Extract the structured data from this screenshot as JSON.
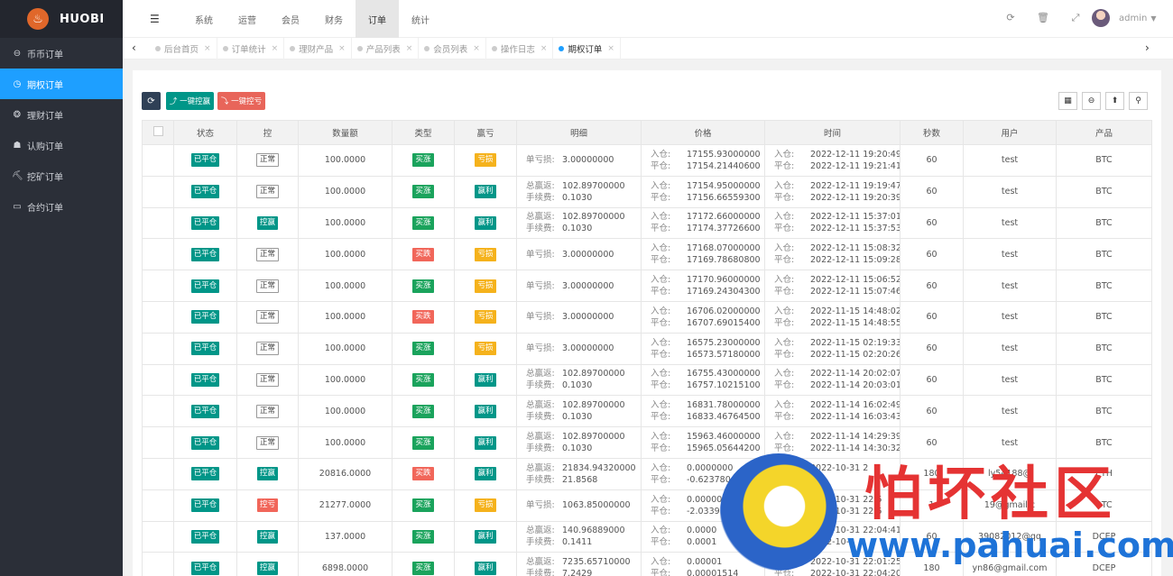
{
  "logo": {
    "text": "HUOBI"
  },
  "sidebar": {
    "items": [
      {
        "label": "币币订单",
        "icon": "coin-icon",
        "glyph": "⊖"
      },
      {
        "label": "期权订单",
        "icon": "clock-icon",
        "glyph": "◷"
      },
      {
        "label": "理财订单",
        "icon": "finance-icon",
        "glyph": "❂"
      },
      {
        "label": "认购订单",
        "icon": "person-walk-icon",
        "glyph": "☗"
      },
      {
        "label": "挖矿订单",
        "icon": "mining-icon",
        "glyph": "⛏"
      },
      {
        "label": "合约订单",
        "icon": "monitor-icon",
        "glyph": "▭"
      }
    ],
    "active_index": 1
  },
  "topnav": {
    "items": [
      "系统",
      "运营",
      "会员",
      "财务",
      "订单",
      "统计"
    ],
    "active_index": 4
  },
  "user": {
    "name": "admin"
  },
  "tabs": {
    "items": [
      "后台首页",
      "订单统计",
      "理财产品",
      "产品列表",
      "会员列表",
      "操作日志",
      "期权订单"
    ],
    "active_index": 6
  },
  "toolbar": {
    "refresh": "⟳",
    "btn_win": "⤴ 一键控赢",
    "btn_lose": "⤵ 一键控亏"
  },
  "table": {
    "headers": [
      "状态",
      "控",
      "数量额",
      "类型",
      "赢亏",
      "明细",
      "价格",
      "时间",
      "秒数",
      "用户",
      "产品"
    ],
    "labels": {
      "single_loss": "单亏损:",
      "total_profit": "总赢返:",
      "fee": "手续费:",
      "in": "入仓:",
      "out": "平仓:"
    },
    "rows": [
      {
        "status": "已平仓",
        "ctrl": "正常",
        "amount": "100.0000",
        "type": "买涨",
        "result": "亏损",
        "d1": [
          "单亏损:",
          "3.00000000"
        ],
        "d2": null,
        "p_in": "17155.93000000",
        "p_out": "17154.21440600",
        "t_in": "2022-12-11 19:20:49",
        "t_out": "2022-12-11 19:21:41",
        "sec": "60",
        "user": "test",
        "product": "BTC"
      },
      {
        "status": "已平仓",
        "ctrl": "正常",
        "amount": "100.0000",
        "type": "买涨",
        "result": "赢利",
        "d1": [
          "总赢返:",
          "102.89700000"
        ],
        "d2": [
          "手续费:",
          "0.1030"
        ],
        "p_in": "17154.95000000",
        "p_out": "17156.66559300",
        "t_in": "2022-12-11 19:19:47",
        "t_out": "2022-12-11 19:20:39",
        "sec": "60",
        "user": "test",
        "product": "BTC"
      },
      {
        "status": "已平仓",
        "ctrl": "控赢",
        "amount": "100.0000",
        "type": "买涨",
        "result": "赢利",
        "d1": [
          "总赢返:",
          "102.89700000"
        ],
        "d2": [
          "手续费:",
          "0.1030"
        ],
        "p_in": "17172.66000000",
        "p_out": "17174.37726600",
        "t_in": "2022-12-11 15:37:01",
        "t_out": "2022-12-11 15:37:53",
        "sec": "60",
        "user": "test",
        "product": "BTC"
      },
      {
        "status": "已平仓",
        "ctrl": "正常",
        "amount": "100.0000",
        "type": "买跌",
        "result": "亏损",
        "d1": [
          "单亏损:",
          "3.00000000"
        ],
        "d2": null,
        "p_in": "17168.07000000",
        "p_out": "17169.78680800",
        "t_in": "2022-12-11 15:08:32",
        "t_out": "2022-12-11 15:09:28",
        "sec": "60",
        "user": "test",
        "product": "BTC"
      },
      {
        "status": "已平仓",
        "ctrl": "正常",
        "amount": "100.0000",
        "type": "买涨",
        "result": "亏损",
        "d1": [
          "单亏损:",
          "3.00000000"
        ],
        "d2": null,
        "p_in": "17170.96000000",
        "p_out": "17169.24304300",
        "t_in": "2022-12-11 15:06:52",
        "t_out": "2022-12-11 15:07:46",
        "sec": "60",
        "user": "test",
        "product": "BTC"
      },
      {
        "status": "已平仓",
        "ctrl": "正常",
        "amount": "100.0000",
        "type": "买跌",
        "result": "亏损",
        "d1": [
          "单亏损:",
          "3.00000000"
        ],
        "d2": null,
        "p_in": "16706.02000000",
        "p_out": "16707.69015400",
        "t_in": "2022-11-15 14:48:02",
        "t_out": "2022-11-15 14:48:55",
        "sec": "60",
        "user": "test",
        "product": "BTC"
      },
      {
        "status": "已平仓",
        "ctrl": "正常",
        "amount": "100.0000",
        "type": "买涨",
        "result": "亏损",
        "d1": [
          "单亏损:",
          "3.00000000"
        ],
        "d2": null,
        "p_in": "16575.23000000",
        "p_out": "16573.57180000",
        "t_in": "2022-11-15 02:19:33",
        "t_out": "2022-11-15 02:20:26",
        "sec": "60",
        "user": "test",
        "product": "BTC"
      },
      {
        "status": "已平仓",
        "ctrl": "正常",
        "amount": "100.0000",
        "type": "买涨",
        "result": "赢利",
        "d1": [
          "总赢返:",
          "102.89700000"
        ],
        "d2": [
          "手续费:",
          "0.1030"
        ],
        "p_in": "16755.43000000",
        "p_out": "16757.10215100",
        "t_in": "2022-11-14 20:02:07",
        "t_out": "2022-11-14 20:03:01",
        "sec": "60",
        "user": "test",
        "product": "BTC"
      },
      {
        "status": "已平仓",
        "ctrl": "正常",
        "amount": "100.0000",
        "type": "买涨",
        "result": "赢利",
        "d1": [
          "总赢返:",
          "102.89700000"
        ],
        "d2": [
          "手续费:",
          "0.1030"
        ],
        "p_in": "16831.78000000",
        "p_out": "16833.46764500",
        "t_in": "2022-11-14 16:02:49",
        "t_out": "2022-11-14 16:03:43",
        "sec": "60",
        "user": "test",
        "product": "BTC"
      },
      {
        "status": "已平仓",
        "ctrl": "正常",
        "amount": "100.0000",
        "type": "买涨",
        "result": "赢利",
        "d1": [
          "总赢返:",
          "102.89700000"
        ],
        "d2": [
          "手续费:",
          "0.1030"
        ],
        "p_in": "15963.46000000",
        "p_out": "15965.05644200",
        "t_in": "2022-11-14 14:29:39",
        "t_out": "2022-11-14 14:30:32",
        "sec": "60",
        "user": "test",
        "product": "BTC"
      },
      {
        "status": "已平仓",
        "ctrl": "控赢",
        "amount": "20816.0000",
        "type": "买跌",
        "result": "赢利",
        "d1": [
          "总赢返:",
          "21834.94320000"
        ],
        "d2": [
          "手续费:",
          "21.8568"
        ],
        "p_in": "0.0000000",
        "p_out": "-0.623780",
        "t_in": "2022-10-31 2",
        "t_out": "",
        "sec": "180",
        "user": "ly54188@",
        "product": "ETH"
      },
      {
        "status": "已平仓",
        "ctrl": "控亏",
        "amount": "21277.0000",
        "type": "买涨",
        "result": "亏损",
        "d1": [
          "单亏损:",
          "1063.85000000"
        ],
        "d2": null,
        "p_in": "0.0000000",
        "p_out": "-2.0339",
        "t_in": "2022-10-31 22:5",
        "t_out": "2022-10-31 22:5",
        "sec": "1",
        "user": "19@gmail.c",
        "product": "BTC"
      },
      {
        "status": "已平仓",
        "ctrl": "控赢",
        "amount": "137.0000",
        "type": "买涨",
        "result": "赢利",
        "d1": [
          "总赢返:",
          "140.96889000"
        ],
        "d2": [
          "手续费:",
          "0.1411"
        ],
        "p_in": "0.0000",
        "p_out": "0.0001",
        "t_in": "2022-10-31 22:04:41",
        "t_out": "2022-10-3",
        "sec": "60",
        "user": "39082012@qq",
        "product": "DCEP"
      },
      {
        "status": "已平仓",
        "ctrl": "控赢",
        "amount": "6898.0000",
        "type": "买涨",
        "result": "赢利",
        "d1": [
          "总赢返:",
          "7235.65710000"
        ],
        "d2": [
          "手续费:",
          "7.2429"
        ],
        "p_in": "0.00001",
        "p_out": "0.00001514",
        "t_in": "2022-10-31 22:01:25",
        "t_out": "2022-10-31 22:04:20",
        "sec": "180",
        "user": "yn86@gmail.com",
        "product": "DCEP"
      }
    ]
  },
  "watermark": {
    "text": "怕坏社区",
    "url": "www.pahuai.com"
  }
}
